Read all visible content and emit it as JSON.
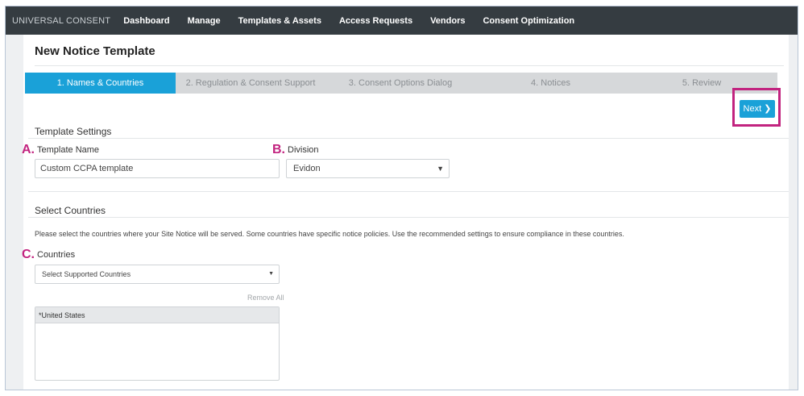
{
  "nav": {
    "brand": "UNIVERSAL CONSENT",
    "items": [
      "Dashboard",
      "Manage",
      "Templates & Assets",
      "Access Requests",
      "Vendors",
      "Consent Optimization"
    ]
  },
  "page": {
    "title": "New Notice Template"
  },
  "steps": [
    {
      "label": "1. Names & Countries",
      "active": true
    },
    {
      "label": "2. Regulation & Consent Support",
      "active": false
    },
    {
      "label": "3. Consent Options Dialog",
      "active": false
    },
    {
      "label": "4. Notices",
      "active": false
    },
    {
      "label": "5. Review",
      "active": false
    }
  ],
  "next_button": {
    "label": "Next",
    "icon": "chevron-right-icon"
  },
  "template_settings": {
    "title": "Template Settings",
    "name_label": "Template Name",
    "name_value": "Custom CCPA template",
    "division_label": "Division",
    "division_value": "Evidon"
  },
  "select_countries": {
    "title": "Select Countries",
    "instructions": "Please select the countries where your Site Notice will be served. Some countries have specific notice policies. Use the recommended settings to ensure compliance in these countries.",
    "countries_label": "Countries",
    "dropdown_placeholder": "Select Supported Countries",
    "remove_all": "Remove All",
    "selected": [
      "*United States"
    ]
  },
  "markers": {
    "a": "A.",
    "b": "B.",
    "c": "C."
  },
  "colors": {
    "accent": "#1aa1d8",
    "highlight": "#c2237f",
    "nav_bg": "#353c41"
  }
}
